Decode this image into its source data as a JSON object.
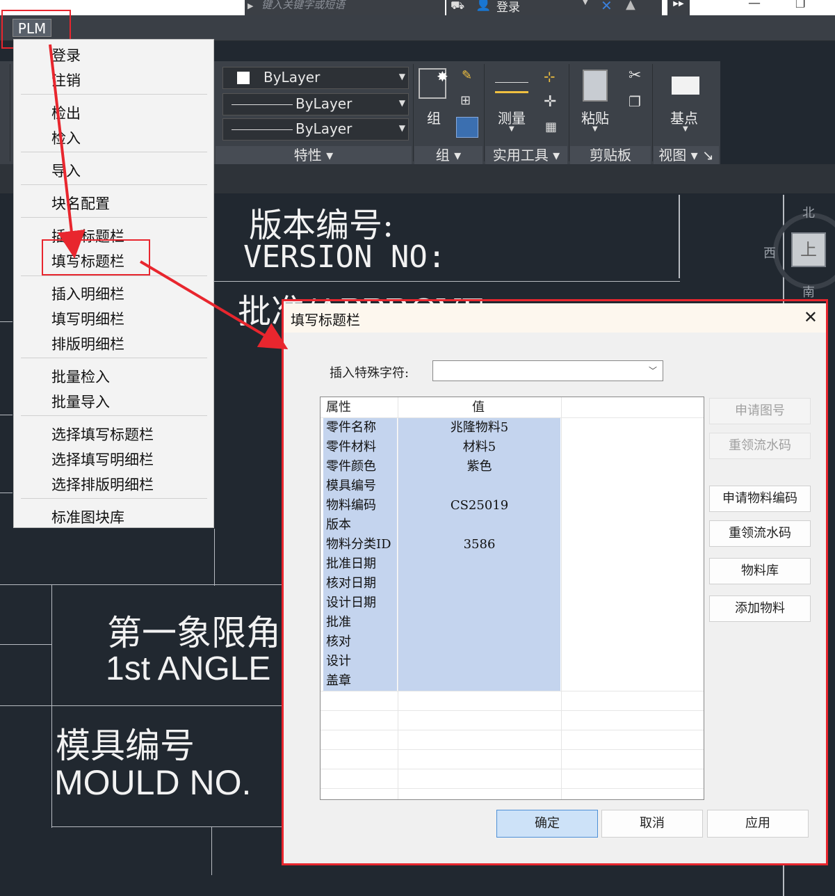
{
  "titlebar": {
    "search_placeholder": "键入关键字或短语",
    "login_label": "登录",
    "window_min": "—",
    "window_restore": "❐"
  },
  "menubar": {
    "plm_label": "PLM"
  },
  "ribbon": {
    "layer_combo": "ByLayer",
    "linetype_combo": "ByLayer",
    "lineweight_combo": "ByLayer",
    "panel_properties": "特性",
    "panel_group": "组",
    "panel_utilities": "实用工具",
    "panel_clipboard": "剪贴板",
    "panel_view": "视图",
    "group_btn": "组",
    "measure_btn": "测量",
    "paste_btn": "粘贴",
    "basepoint_btn": "基点"
  },
  "compass": {
    "north": "北",
    "west": "西",
    "south": "南",
    "top": "上"
  },
  "drawing": {
    "version_cn": "版本编号:",
    "version_en": "VERSION NO:",
    "approve": "批准/APPROVE",
    "angle_cn": "第一象限角",
    "angle_en": "1st ANGLE",
    "mould_cn": "模具编号",
    "mould_en": "MOULD NO."
  },
  "plm_menu": {
    "items": [
      "登录",
      "注销",
      "检出",
      "检入",
      "导入",
      "块名配置",
      "插入标题栏",
      "填写标题栏",
      "插入明细栏",
      "填写明细栏",
      "排版明细栏",
      "批量检入",
      "批量导入",
      "选择填写标题栏",
      "选择填写明细栏",
      "选择排版明细栏",
      "标准图块库"
    ]
  },
  "dialog": {
    "title": "填写标题栏",
    "special_char_label": "插入特殊字符:",
    "special_char_value": "",
    "col_attr": "属性",
    "col_value": "值",
    "rows": [
      {
        "attr": "零件名称",
        "value": "兆隆物料5"
      },
      {
        "attr": "零件材料",
        "value": "材料5"
      },
      {
        "attr": "零件颜色",
        "value": "紫色"
      },
      {
        "attr": "模具编号",
        "value": ""
      },
      {
        "attr": "物料编码",
        "value": "CS25019"
      },
      {
        "attr": "版本",
        "value": ""
      },
      {
        "attr": "物料分类ID",
        "value": "3586"
      },
      {
        "attr": "批准日期",
        "value": ""
      },
      {
        "attr": "核对日期",
        "value": ""
      },
      {
        "attr": "设计日期",
        "value": ""
      },
      {
        "attr": "批准",
        "value": ""
      },
      {
        "attr": "核对",
        "value": ""
      },
      {
        "attr": "设计",
        "value": ""
      },
      {
        "attr": "盖章",
        "value": ""
      }
    ],
    "btn_apply_drawing_no": "申请图号",
    "btn_reget_serial_1": "重领流水码",
    "btn_apply_material_code": "申请物料编码",
    "btn_reget_serial_2": "重领流水码",
    "btn_material_lib": "物料库",
    "btn_add_material": "添加物料",
    "btn_ok": "确定",
    "btn_cancel": "取消",
    "btn_apply": "应用"
  }
}
